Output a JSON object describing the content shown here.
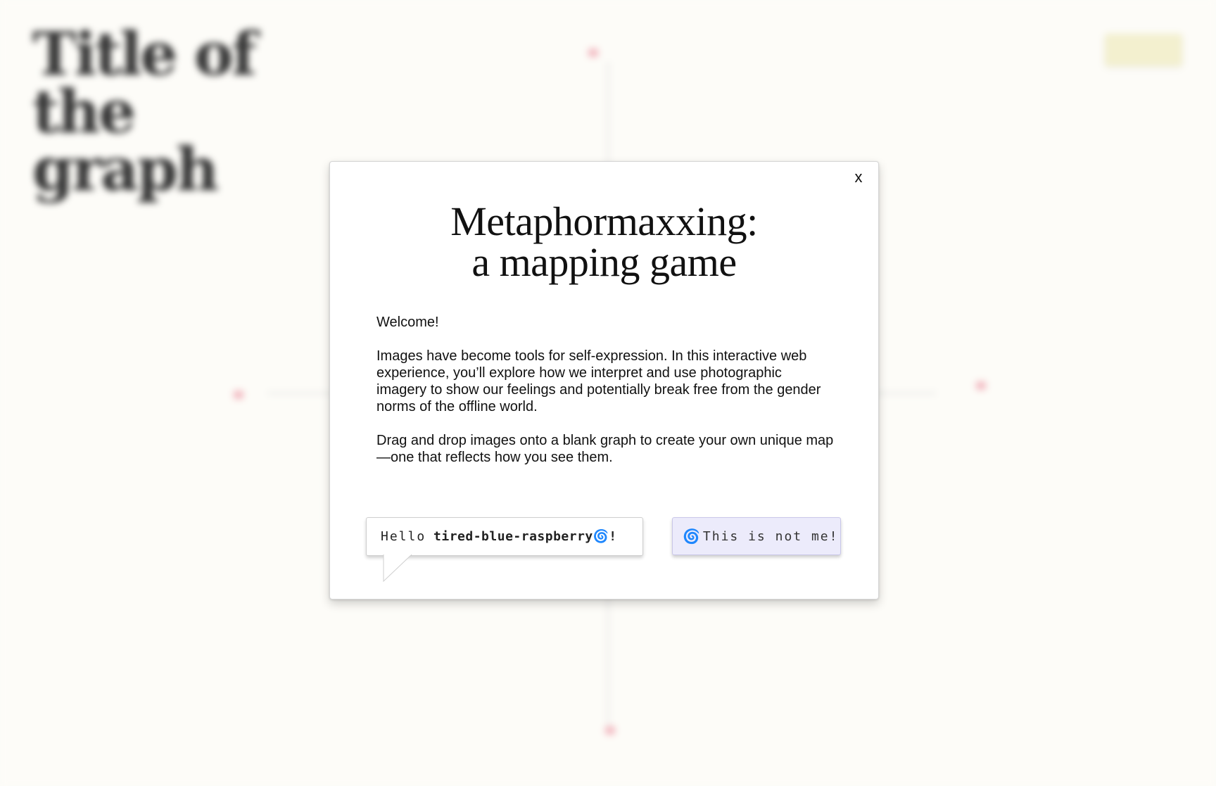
{
  "background": {
    "title": "Title of the graph",
    "top_axis_label": "",
    "left_axis_label": "",
    "right_axis_label": "",
    "bottom_axis_label": "",
    "button_label": "",
    "accent": "#f2b8c0"
  },
  "modal": {
    "close_label": "x",
    "title_line1": "Metaphormaxxing:",
    "title_line2": "a mapping game",
    "welcome": "Welcome!",
    "paragraph1": "Images have become tools for self-expression. In this interactive web experience, you’ll explore how we interpret and use photographic imagery to show our feelings and potentially break free from the gender norms of the offline world.",
    "paragraph2": "Drag and drop images onto a blank graph to create your own unique map—one that reflects how you see them.",
    "greeting": "Hello",
    "username": "tired-blue-raspberry",
    "greeting_end": "!",
    "not_me_label": "This is not me!",
    "swirl_icon": "swirl-icon",
    "accent_color": "#4b3ee0",
    "button_bg": "#ecebfb"
  }
}
